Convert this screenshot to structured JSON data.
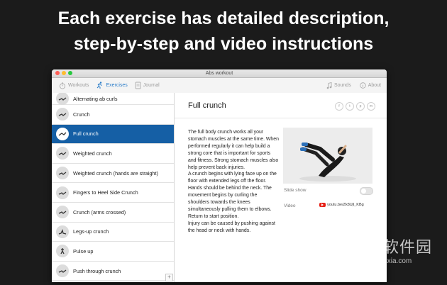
{
  "headline": {
    "line1": "Each exercise has detailed description,",
    "line2": "step-by-step and video instructions"
  },
  "window": {
    "title": "Abs workout",
    "traffic_colors": [
      "#ff5f57",
      "#febc2e",
      "#28c840"
    ]
  },
  "toolbar": {
    "workouts_label": "Workouts",
    "exercises_label": "Exercises",
    "journal_label": "Journal",
    "sounds_label": "Sounds",
    "about_label": "About",
    "accent_color": "#2b7dc9"
  },
  "sidebar": {
    "items": [
      {
        "label": "Alternating ab curls"
      },
      {
        "label": "Crunch"
      },
      {
        "label": "Full crunch",
        "selected": true
      },
      {
        "label": "Weighted crunch"
      },
      {
        "label": "Weighted crunch (hands are straight)"
      },
      {
        "label": "Fingers to Heel Side Crunch"
      },
      {
        "label": "Crunch (arms crossed)"
      },
      {
        "label": "Legs-up crunch"
      },
      {
        "label": "Pulse up"
      },
      {
        "label": "Push through crunch"
      }
    ],
    "add_label": "+"
  },
  "detail": {
    "title": "Full crunch",
    "share_icons": [
      "f",
      "t",
      "p",
      "m"
    ],
    "description": "The full body crunch works all your stomach muscles at the same time. When performed regularly it can help build a strong core that is important for sports and fitness. Strong stomach muscles also help prevent back injuries.\nA crunch begins with lying face up on the floor with extended legs off the floor. Hands should be behind the neck. The movement begins by curling the shoulders towards the knees simultaneously pulling them to elbows. Return to start position.\nInjury can be caused by pushing against the head or neck with hands.",
    "slideshow_label": "Slide show",
    "video_label": "Video",
    "video_url": "youtu.be/Zk8Ujl_KBg"
  },
  "watermark": {
    "logo": "↓",
    "text": "当下软件园",
    "url": "www.downxia.com"
  }
}
